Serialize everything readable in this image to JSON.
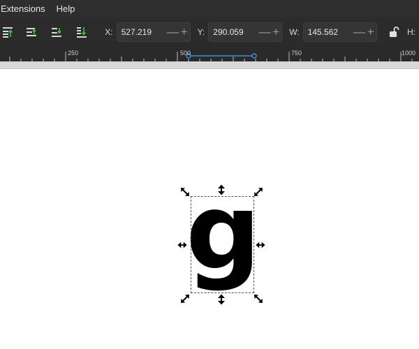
{
  "menu": {
    "items": [
      "Extensions",
      "Help"
    ]
  },
  "toolbar": {
    "align_buttons": [
      "raise-to-top-icon",
      "raise-icon",
      "lower-icon",
      "lower-to-bottom-icon"
    ],
    "x": {
      "label": "X:",
      "value": "527.219"
    },
    "y": {
      "label": "Y:",
      "value": "290.059"
    },
    "w": {
      "label": "W:",
      "value": "145.562"
    },
    "h": {
      "label": "H:"
    },
    "minus_glyph": "—",
    "plus_glyph": "+"
  },
  "ruler": {
    "labels": [
      "250",
      "500",
      "750",
      "1000"
    ]
  },
  "canvas": {
    "glyph": "g"
  },
  "colors": {
    "menubar": "#2e2e2e",
    "toolbar": "#2b2b2b",
    "ruler": "#2a2a2a",
    "arrow_green": "#3ec43e",
    "selection": "#4a4a8a",
    "ruler_highlight": "#3b8fd6"
  }
}
